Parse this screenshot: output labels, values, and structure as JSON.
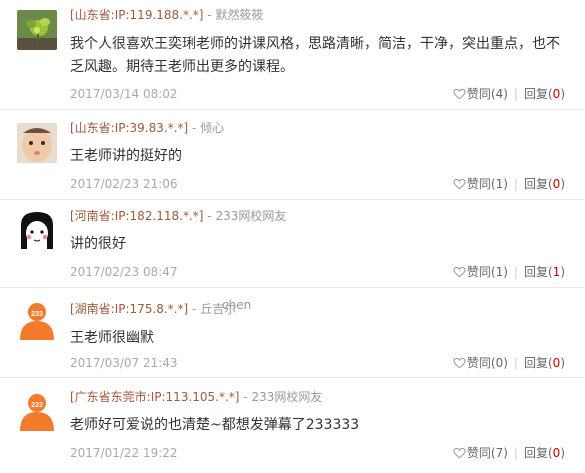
{
  "comments": [
    {
      "location": "[山东省:IP:119.188.*.*]",
      "separator": "-",
      "user": "默然筱筱",
      "text": "我个人很喜欢王奕琍老师的讲课风格，思路清晰，简洁，干净，突出重点，也不乏风趣。期待王老师出更多的课程。",
      "date": "2017/03/14 08:02",
      "like_label": "赞同",
      "like_open": "(",
      "like_count": "4",
      "like_close": ")",
      "reply_label": "回复",
      "reply_open": "(",
      "reply_count": "0",
      "reply_close": ")"
    },
    {
      "location": "[山东省:IP:39.83.*.*]",
      "separator": "-",
      "user": "倾心",
      "text": "王老师讲的挺好的",
      "date": "2017/02/23 21:06",
      "like_label": "赞同",
      "like_open": "(",
      "like_count": "1",
      "like_close": ")",
      "reply_label": "回复",
      "reply_open": "(",
      "reply_count": "0",
      "reply_close": ")"
    },
    {
      "location": "[河南省:IP:182.118.*.*]",
      "separator": "-",
      "user": "233网校网友",
      "text": "讲的很好",
      "date": "2017/02/23 08:47",
      "like_label": "赞同",
      "like_open": "(",
      "like_count": "1",
      "like_close": ")",
      "reply_label": "回复",
      "reply_open": "(",
      "reply_count": "1",
      "reply_close": ")"
    },
    {
      "location": "[湖南省:IP:175.8.*.*]",
      "separator": "-",
      "user": "丘吉尔",
      "text": "王老师很幽默",
      "date": "2017/03/07 21:43",
      "like_label": "赞同",
      "like_open": "(",
      "like_count": "0",
      "like_close": ")",
      "reply_label": "回复",
      "reply_open": "(",
      "reply_count": "0",
      "reply_close": ")"
    },
    {
      "location": "[广东省东莞市:IP:113.105.*.*]",
      "separator": "-",
      "user": "233网校网友",
      "text": "老师好可爱说的也清楚~都想发弹幕了233333",
      "date": "2017/01/22 19:22",
      "like_label": "赞同",
      "like_open": "(",
      "like_count": "7",
      "like_close": ")",
      "reply_label": "回复",
      "reply_open": "(",
      "reply_count": "0",
      "reply_close": ")"
    }
  ],
  "stray_text": "chen",
  "avatar_badge": "233",
  "icons": {
    "like": "heart-outline-icon"
  },
  "colors": {
    "location": "#a05a3c",
    "meta": "#999999",
    "content": "#333333",
    "date": "#aaaaaa",
    "count_highlight": "#cc0000",
    "avatar_orange": "#f37b2b",
    "divider": "#e8e8e8"
  }
}
